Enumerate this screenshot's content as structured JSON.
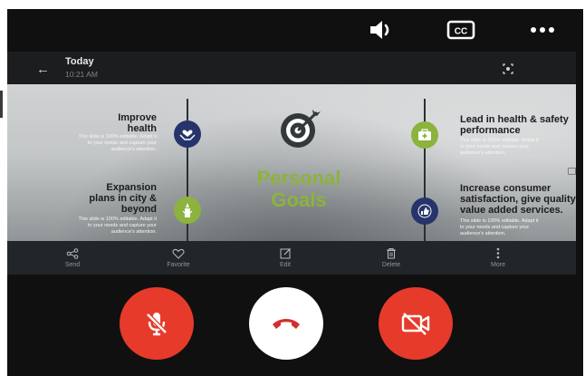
{
  "call_bar": {
    "icons": [
      "speaker-icon",
      "closed-captions-icon",
      "more-icon"
    ],
    "cc_label": "CC"
  },
  "viewer": {
    "title": "Today",
    "time": "10:21 AM"
  },
  "slide": {
    "title_line1": "Personal",
    "title_line2": "Goals",
    "items": [
      {
        "heading": "Improve\nhealth",
        "body": "This slide is 100% editable. Adapt it\nto your needs and capture your\naudience's attention."
      },
      {
        "heading": "Expansion\nplans in city &\nbeyond",
        "body": "This slide is 100% editable. Adapt it\nto your needs and capture your\naudience's attention."
      },
      {
        "heading": "Lead in health & safety\nperformance",
        "body": "This slide is 100% editable. Adapt it\nto your needs and capture your\naudience's attention."
      },
      {
        "heading": "Increase consumer\nsatisfaction, give quality\nvalue added services.",
        "body": "This slide is 100% editable. Adapt it\nto your needs and capture your\naudience's attention."
      }
    ],
    "colors": {
      "navy": "#27346b",
      "green": "#8cb33d"
    }
  },
  "toolbar": {
    "send": "Send",
    "favorite": "Favorite",
    "edit": "Edit",
    "delete": "Delete",
    "more": "More"
  },
  "controls": {
    "mute_color": "#e63b2b",
    "end_color": "#ffffff",
    "video_color": "#e63b2b",
    "end_icon_color": "#d32f2f"
  }
}
